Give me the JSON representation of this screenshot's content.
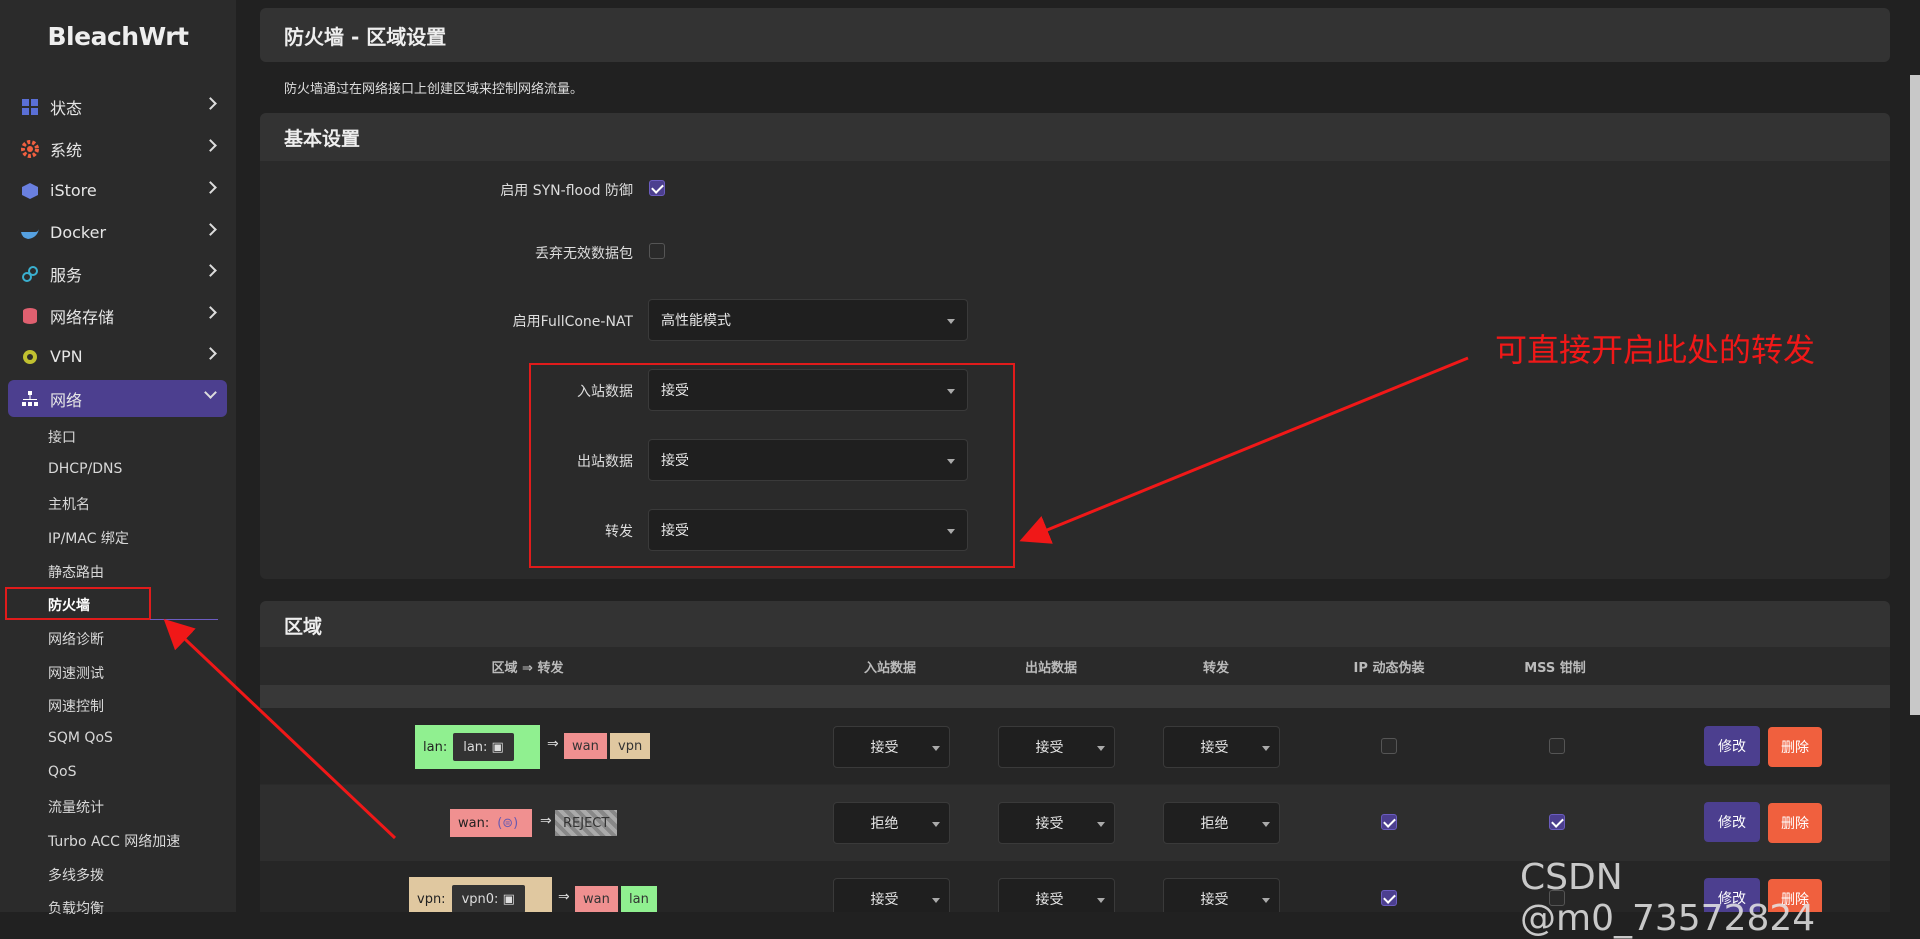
{
  "brand": "BleachWrt",
  "sidebar": {
    "menu": [
      {
        "label": "状态",
        "icon": "dashboard-icon"
      },
      {
        "label": "系统",
        "icon": "gear-icon"
      },
      {
        "label": "iStore",
        "icon": "cube-icon"
      },
      {
        "label": "Docker",
        "icon": "docker-icon"
      },
      {
        "label": "服务",
        "icon": "link-icon"
      },
      {
        "label": "网络存储",
        "icon": "database-icon"
      },
      {
        "label": "VPN",
        "icon": "vpn-icon"
      },
      {
        "label": "网络",
        "icon": "network-icon"
      }
    ],
    "sub": [
      "接口",
      "DHCP/DNS",
      "主机名",
      "IP/MAC 绑定",
      "静态路由",
      "防火墙",
      "网络诊断",
      "网速测试",
      "网速控制",
      "SQM QoS",
      "QoS",
      "流量统计",
      "Turbo ACC 网络加速",
      "多线多拨",
      "负载均衡"
    ]
  },
  "page": {
    "title": "防火墙 - 区域设置",
    "description": "防火墙通过在网络接口上创建区域来控制网络流量。"
  },
  "basic": {
    "header": "基本设置",
    "syn_flood_label": "启用 SYN-flood 防御",
    "drop_invalid_label": "丢弃无效数据包",
    "fullcone_label": "启用FullCone-NAT",
    "fullcone_value": "高性能模式",
    "input_label": "入站数据",
    "input_value": "接受",
    "output_label": "出站数据",
    "output_value": "接受",
    "forward_label": "转发",
    "forward_value": "接受"
  },
  "annotation": "可直接开启此处的转发",
  "zones": {
    "header": "区域",
    "columns": [
      "区域 ⇒ 转发",
      "入站数据",
      "出站数据",
      "转发",
      "IP 动态伪装",
      "MSS 钳制"
    ],
    "arrow": "⇒",
    "rows": [
      {
        "zone": "lan:",
        "iface": "lan:",
        "targets": [
          "wan",
          "vpn"
        ],
        "input": "接受",
        "output": "接受",
        "forward": "接受"
      },
      {
        "zone": "wan:",
        "iface": "",
        "targets": [
          "REJECT"
        ],
        "input": "拒绝",
        "output": "接受",
        "forward": "拒绝"
      },
      {
        "zone": "vpn:",
        "iface": "vpn0:",
        "targets": [
          "wan",
          "lan"
        ],
        "input": "接受",
        "output": "接受",
        "forward": "接受"
      }
    ],
    "edit_label": "修改",
    "delete_label": "删除"
  },
  "watermark": "CSDN @m0_73572824",
  "colors": {
    "accent": "#4c3f8f",
    "danger": "#f0603e",
    "annotation": "#f01818",
    "lan": "#90f090",
    "wan": "#f09090",
    "vpn": "#e0c8a0"
  }
}
